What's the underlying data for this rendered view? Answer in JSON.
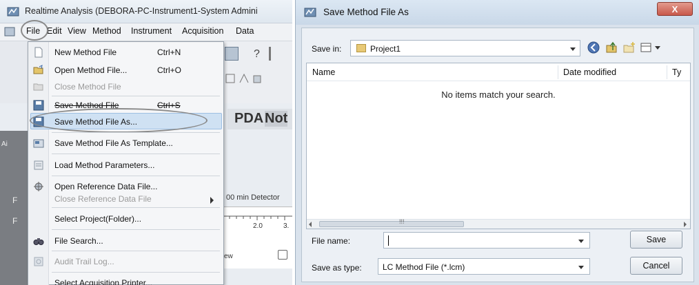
{
  "app": {
    "title": "Realtime Analysis (DEBORA-PC-Instrument1-System Admini",
    "menus": [
      "File",
      "Edit",
      "View",
      "Method",
      "Instrument",
      "Acquisition",
      "Data"
    ],
    "pda_label": "PDA",
    "pda_status": "Not",
    "detector_text": "00 min Detector",
    "axis_ticks": [
      "2.0",
      "3."
    ],
    "side_letters": [
      "Ai",
      "F",
      "F"
    ],
    "misc_text": "ew"
  },
  "file_menu": {
    "items": [
      {
        "label": "New Method File",
        "shortcut": "Ctrl+N",
        "icon": "new-file-icon",
        "enabled": true
      },
      {
        "label": "Open Method File...",
        "shortcut": "Ctrl+O",
        "icon": "open-folder-icon",
        "enabled": true
      },
      {
        "label": "Close Method File",
        "shortcut": "",
        "icon": "close-file-icon",
        "enabled": false
      },
      {
        "label": "Save Method File",
        "shortcut": "Ctrl+S",
        "icon": "save-icon",
        "enabled": true
      },
      {
        "label": "Save Method File As...",
        "shortcut": "",
        "icon": "save-as-icon",
        "enabled": true,
        "highlighted": true
      },
      {
        "label": "Save Method File As Template...",
        "shortcut": "",
        "icon": "template-icon",
        "enabled": true
      },
      {
        "label": "Load Method Parameters...",
        "shortcut": "",
        "icon": "load-parameters-icon",
        "enabled": true
      },
      {
        "label": "Open Reference Data File...",
        "shortcut": "",
        "icon": "reference-data-icon",
        "enabled": true
      },
      {
        "label": "Close Reference Data File",
        "shortcut": "",
        "icon": "",
        "enabled": false,
        "submenu": true
      },
      {
        "label": "Select Project(Folder)...",
        "shortcut": "",
        "icon": "",
        "enabled": true
      },
      {
        "label": "File Search...",
        "shortcut": "",
        "icon": "binoculars-icon",
        "enabled": true
      },
      {
        "label": "Audit Trail Log...",
        "shortcut": "",
        "icon": "audit-log-icon",
        "enabled": false
      },
      {
        "label": "Select Acquisition Printer...",
        "shortcut": "",
        "icon": "",
        "enabled": true
      }
    ]
  },
  "dialog": {
    "title": "Save Method File As",
    "close_label": "X",
    "save_in_label": "Save in:",
    "save_in_value": "Project1",
    "columns": [
      "Name",
      "Date modified",
      "Ty"
    ],
    "empty_message": "No items match your search.",
    "scroll_grip": "!!!",
    "file_name_label": "File name:",
    "file_name_value": "",
    "save_as_type_label": "Save as type:",
    "save_as_type_value": "LC Method File (*.lcm)",
    "save_button": "Save",
    "cancel_button": "Cancel"
  }
}
